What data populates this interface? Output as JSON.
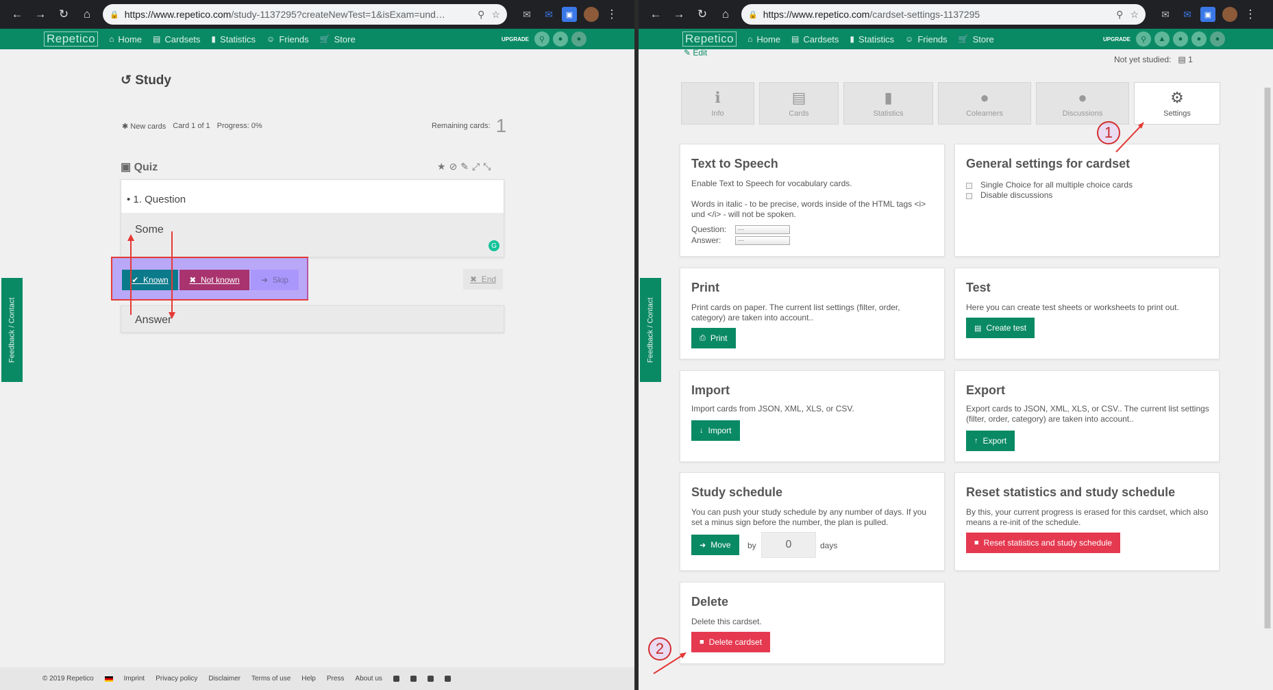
{
  "left": {
    "url_host": "https://www.repetico.com",
    "url_path": "/study-1137295?createNewTest=1&isExam=und…",
    "nav": {
      "logo": "Repetico",
      "items": [
        "Home",
        "Cardsets",
        "Statistics",
        "Friends",
        "Store"
      ],
      "upgrade": "UPGRADE"
    },
    "feedback": "Feedback / Contact",
    "study": {
      "title": "Study",
      "new_cards": "New cards",
      "card_of": "Card 1 of 1",
      "progress": "Progress: 0%",
      "remaining_label": "Remaining cards:",
      "remaining_value": "1"
    },
    "quiz": {
      "title": "Quiz",
      "question_label": "1. Question",
      "question_text": "Some",
      "answer_text": "Answer"
    },
    "buttons": {
      "known": "Known",
      "not_known": "Not known",
      "skip": "Skip",
      "end": "End"
    },
    "footer": {
      "copyright": "© 2019 Repetico",
      "links": [
        "Imprint",
        "Privacy policy",
        "Disclaimer",
        "Terms of use",
        "Help",
        "Press",
        "About us"
      ]
    }
  },
  "right": {
    "url_host": "https://www.repetico.com",
    "url_path": "/cardset-settings-1137295",
    "nav": {
      "logo": "Repetico",
      "items": [
        "Home",
        "Cardsets",
        "Statistics",
        "Friends",
        "Store"
      ],
      "upgrade": "UPGRADE"
    },
    "feedback": "Feedback / Contact",
    "edit": "Edit",
    "not_yet_studied_label": "Not yet studied:",
    "not_yet_studied_value": "1",
    "tabs": [
      "Info",
      "Cards",
      "Statistics",
      "Colearners",
      "Discussions",
      "Settings"
    ],
    "active_tab": "Settings",
    "cards": {
      "tts": {
        "title": "Text to Speech",
        "desc": "Enable Text to Speech for vocabulary cards.",
        "desc2": "Words in italic - to be precise, words inside of the HTML tags <i> und </i> - will not be spoken.",
        "question_label": "Question:",
        "answer_label": "Answer:",
        "select_value": "---"
      },
      "general": {
        "title": "General settings for cardset",
        "opt1": "Single Choice for all multiple choice cards",
        "opt2": "Disable discussions"
      },
      "print": {
        "title": "Print",
        "desc": "Print cards on paper. The current list settings (filter, order, category) are taken into account..",
        "button": "Print"
      },
      "test": {
        "title": "Test",
        "desc": "Here you can create test sheets or worksheets to print out.",
        "button": "Create test"
      },
      "import": {
        "title": "Import",
        "desc": "Import cards from JSON, XML, XLS, or CSV.",
        "button": "Import"
      },
      "export": {
        "title": "Export",
        "desc": "Export cards to JSON, XML, XLS, or CSV.. The current list settings (filter, order, category) are taken into account..",
        "button": "Export"
      },
      "schedule": {
        "title": "Study schedule",
        "desc": "You can push your study schedule by any number of days. If you set a minus sign before the number, the plan is pulled.",
        "button": "Move",
        "by": "by",
        "days_value": "0",
        "days": "days"
      },
      "reset": {
        "title": "Reset statistics and study schedule",
        "desc": "By this, your current progress is erased for this cardset, which also means a re-init of the schedule.",
        "button": "Reset statistics and study schedule"
      },
      "delete": {
        "title": "Delete",
        "desc": "Delete this cardset.",
        "button": "Delete cardset"
      }
    },
    "annotations": [
      "1",
      "2"
    ]
  },
  "colors": {
    "brand_green": "#0a8a64",
    "danger_red": "#e53950",
    "highlight_purple": "#8c6eff",
    "annotation_red": "#e53935"
  }
}
